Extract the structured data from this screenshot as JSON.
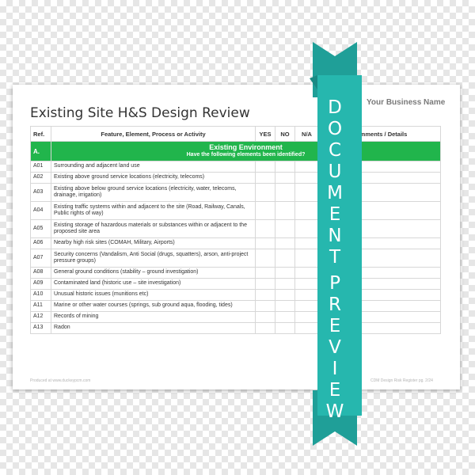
{
  "document": {
    "title": "Existing Site H&S Design Review",
    "business_name": "Your Business Name",
    "columns": {
      "ref": "Ref.",
      "feature": "Feature, Element, Process or Activity",
      "yes": "YES",
      "no": "NO",
      "na": "N/A",
      "comments": "Comments / Details"
    },
    "section": {
      "ref": "A.",
      "title": "Existing Environment",
      "subtitle": "Have the following elements been identified?"
    },
    "rows": [
      {
        "ref": "A01",
        "text": "Surrounding and adjacent land use"
      },
      {
        "ref": "A02",
        "text": "Existing above ground service locations (electricity, telecoms)"
      },
      {
        "ref": "A03",
        "text": "Existing above below ground service locations (electricity, water, telecoms, drainage, irrigation)"
      },
      {
        "ref": "A04",
        "text": "Existing traffic systems within and adjacent to the site (Road, Railway, Canals, Public rights of way)"
      },
      {
        "ref": "A05",
        "text": "Existing storage of hazardous materials or substances within or adjacent to the proposed site area"
      },
      {
        "ref": "A06",
        "text": "Nearby high risk sites (COMAH, Military, Airports)"
      },
      {
        "ref": "A07",
        "text": "Security concerns (Vandalism, Anti Social (drugs, squatters), arson, anti-project pressure groups)"
      },
      {
        "ref": "A08",
        "text": "General ground conditions (stability – ground investigation)"
      },
      {
        "ref": "A09",
        "text": "Contaminated land (historic use – site investigation)"
      },
      {
        "ref": "A10",
        "text": "Unusual historic issues (munitions etc)"
      },
      {
        "ref": "A11",
        "text": "Marine or other water courses (springs, sub ground aqua, flooding, tides)"
      },
      {
        "ref": "A12",
        "text": "Records of mining"
      },
      {
        "ref": "A13",
        "text": "Radon"
      }
    ],
    "footer": {
      "left": "Produced at www.duckeypcm.com",
      "right": "CDM Design Risk Register pg. 2/24"
    }
  },
  "ribbon": {
    "word1": "DOCUMENT",
    "word2": "PREVIEW",
    "color": "#26b7ae"
  },
  "colors": {
    "section_green": "#21b54c",
    "ribbon_teal": "#26b7ae"
  }
}
